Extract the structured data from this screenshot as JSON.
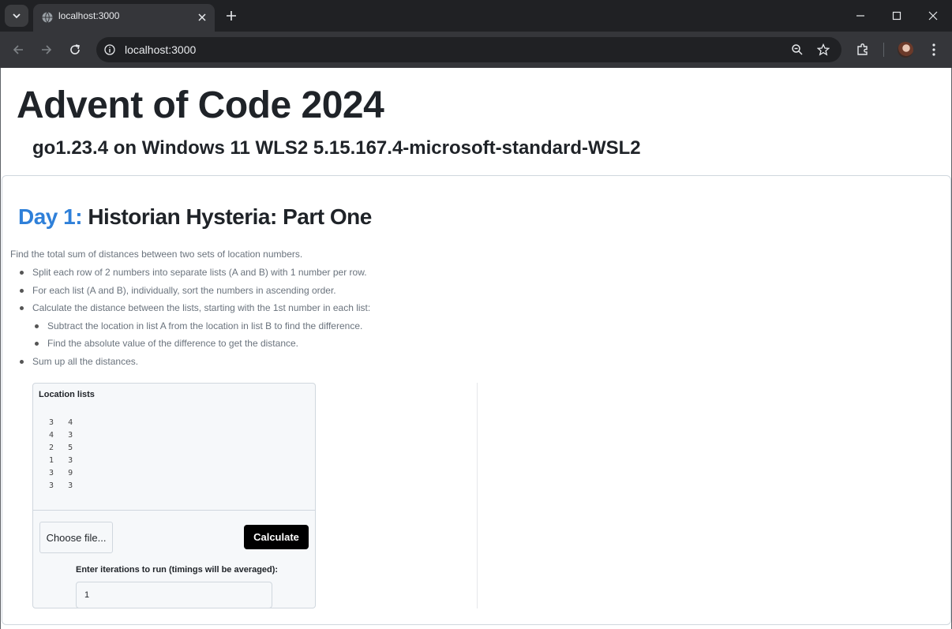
{
  "browser": {
    "tab_title": "localhost:3000",
    "url": "localhost:3000"
  },
  "page": {
    "title": "Advent of Code 2024",
    "subtitle": "go1.23.4 on Windows 11 WLS2 5.15.167.4-microsoft-standard-WSL2"
  },
  "puzzle": {
    "day_label": "Day 1:",
    "name": "Historian Hysteria: Part One",
    "description": "Find the total sum of distances between two sets of location numbers.",
    "steps": [
      "Split each row of 2 numbers into separate lists (A and B) with 1 number per row.",
      "For each list (A and B), individually, sort the numbers in ascending order.",
      "Calculate the distance between the lists, starting with the 1st number in each list:",
      "Subtract the location in list A from the location in list B to find the difference.",
      "Find the absolute value of the difference to get the distance.",
      "Sum up all the distances."
    ]
  },
  "form": {
    "input_label": "Location lists",
    "input_rows": [
      "3   4",
      "4   3",
      "2   5",
      "1   3",
      "3   9",
      "3   3"
    ],
    "choose_file_label": "Choose file...",
    "calculate_label": "Calculate",
    "iterations_label": "Enter iterations to run (timings will be averaged):",
    "iterations_value": "1"
  },
  "colors": {
    "accent_day": "#2f80d9",
    "button_bg": "#000000"
  }
}
